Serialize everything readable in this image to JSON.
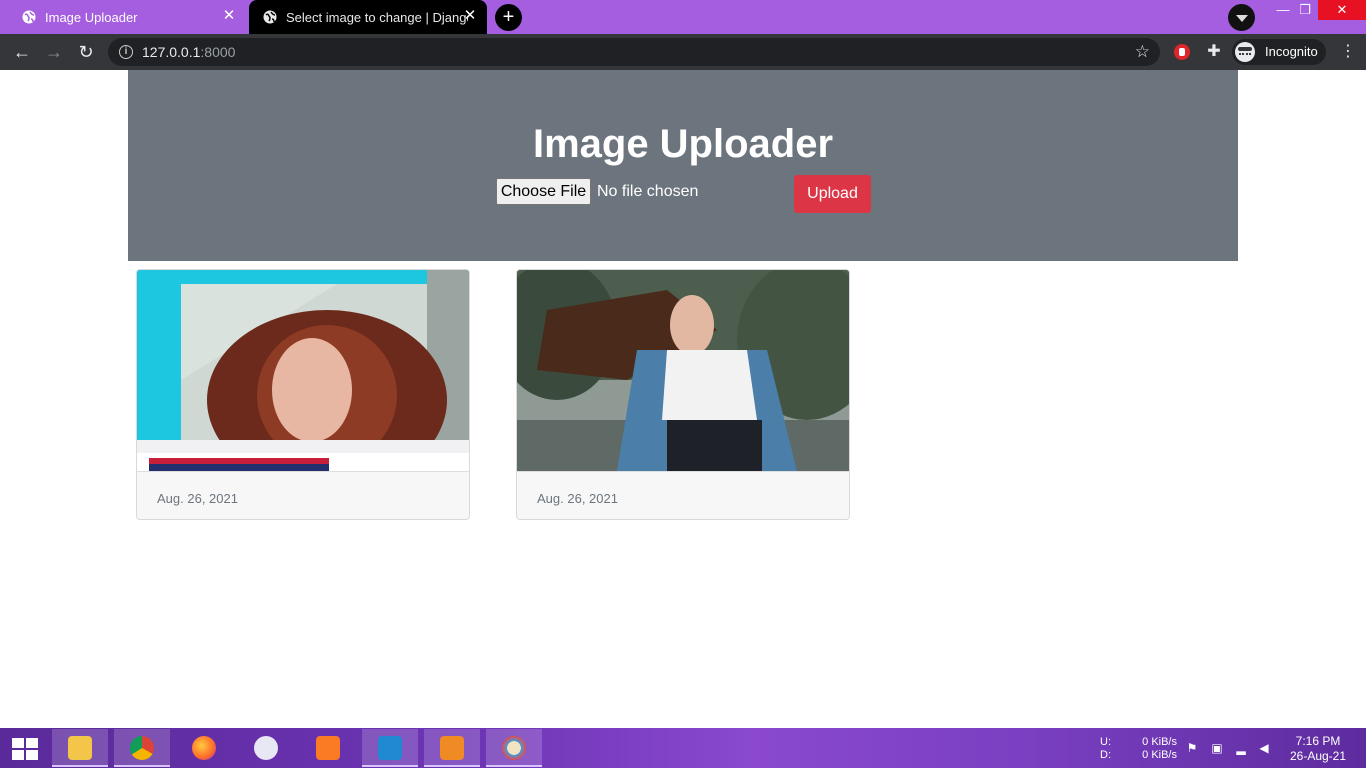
{
  "browser": {
    "tabs": [
      {
        "label": "Image Uploader",
        "active": true
      },
      {
        "label": "Select image to change | Django",
        "active": false
      }
    ],
    "new_tab_symbol": "+",
    "url_host": "127.0.0.1",
    "url_port": ":8000",
    "profile_label": "Incognito",
    "accent_color": "#a55ee0",
    "toolbar_color": "#35363a"
  },
  "page": {
    "title": "Image Uploader",
    "file_input": {
      "button_label": "Choose File",
      "status": "No file chosen"
    },
    "upload_label": "Upload",
    "hero_color": "#6c757d",
    "upload_color": "#dc3545",
    "cards": [
      {
        "date": "Aug. 26, 2021",
        "image": "woman-red-hair-portrait"
      },
      {
        "date": "Aug. 26, 2021",
        "image": "woman-denim-jacket-outdoor"
      }
    ]
  },
  "taskbar": {
    "apps": [
      "file-explorer-icon",
      "chrome-icon",
      "firefox-icon",
      "snipping-tool-icon",
      "xampp-icon",
      "vscode-icon",
      "video-player-icon",
      "paint-icon"
    ],
    "net_labels": {
      "up": "U:",
      "down": "D:"
    },
    "net_speeds": {
      "up": "0 KiB/s",
      "down": "0 KiB/s"
    },
    "time": "7:16 PM",
    "date": "26-Aug-21"
  }
}
